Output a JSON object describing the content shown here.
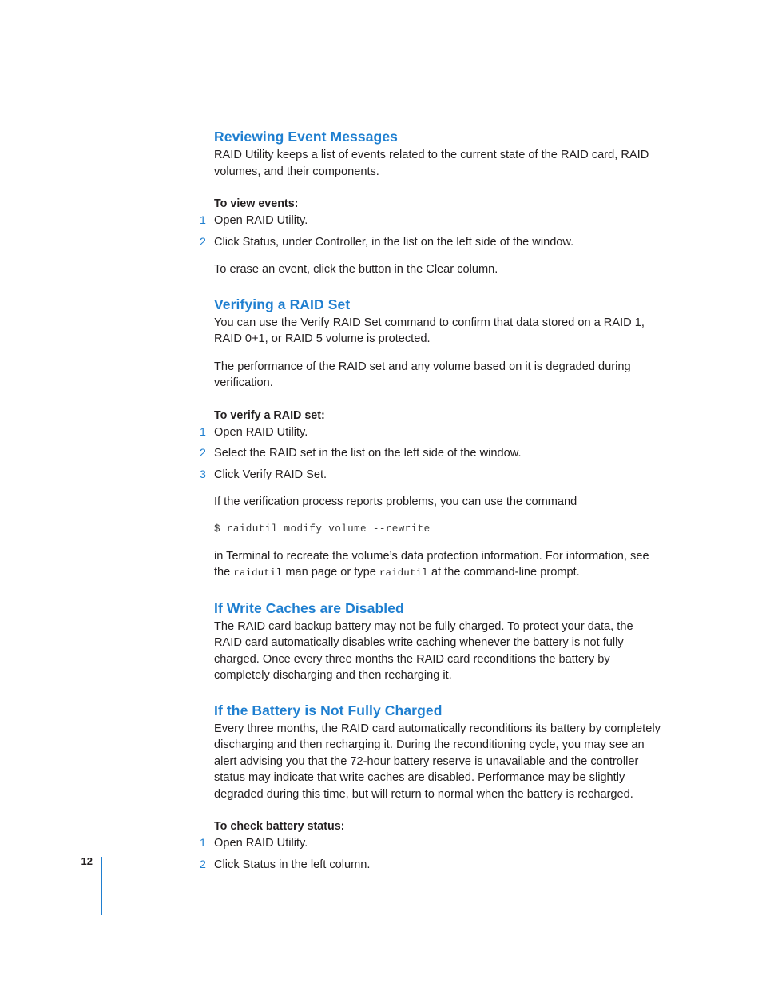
{
  "page": {
    "number": "12",
    "accent_color": "#1f7fd0",
    "text_color": "#231f20"
  },
  "sections": [
    {
      "heading": "Reviewing Event Messages",
      "intro": "RAID Utility keeps a list of events related to the current state of the RAID card, RAID volumes, and their components.",
      "proc_label": "To view events:",
      "steps": [
        {
          "num": "1",
          "text": "Open RAID Utility."
        },
        {
          "num": "2",
          "text": "Click Status, under Controller, in the list on the left side of the window."
        }
      ],
      "note": "To erase an event, click the button in the Clear column."
    },
    {
      "heading": "Verifying a RAID Set",
      "intro": "You can use the Verify RAID Set command to confirm that data stored on a RAID 1, RAID 0+1, or RAID 5 volume is protected.",
      "para2": "The performance of the RAID set and any volume based on it is degraded during verification.",
      "proc_label": "To verify a RAID set:",
      "steps": [
        {
          "num": "1",
          "text": "Open RAID Utility."
        },
        {
          "num": "2",
          "text": "Select the RAID set in the list on the left side of the window."
        },
        {
          "num": "3",
          "text": "Click Verify RAID Set."
        }
      ],
      "note": "If the verification process reports problems, you can use the command",
      "code": "$ raidutil modify volume --rewrite",
      "after_code_1": "in Terminal to recreate the volume’s data protection information. For information, see the ",
      "after_code_code_1": "raidutil",
      "after_code_2": " man page or type ",
      "after_code_code_2": "raidutil",
      "after_code_3": " at the command-line prompt."
    },
    {
      "heading": "If Write Caches are Disabled",
      "intro": "The RAID card backup battery may not be fully charged. To protect your data, the RAID card automatically disables write caching whenever the battery is not fully charged. Once every three months the RAID card reconditions the battery by completely discharging and then recharging it."
    },
    {
      "heading": "If the Battery is Not Fully Charged",
      "intro": "Every three months, the RAID card automatically reconditions its battery by completely discharging and then recharging it. During the reconditioning cycle, you may see an alert advising you that the 72-hour battery reserve is unavailable and the controller status may indicate that write caches are disabled. Performance may be slightly degraded during this time, but will return to normal when the battery is recharged.",
      "proc_label": "To check battery status:",
      "steps": [
        {
          "num": "1",
          "text": "Open RAID Utility."
        },
        {
          "num": "2",
          "text": "Click Status in the left column."
        }
      ]
    }
  ]
}
